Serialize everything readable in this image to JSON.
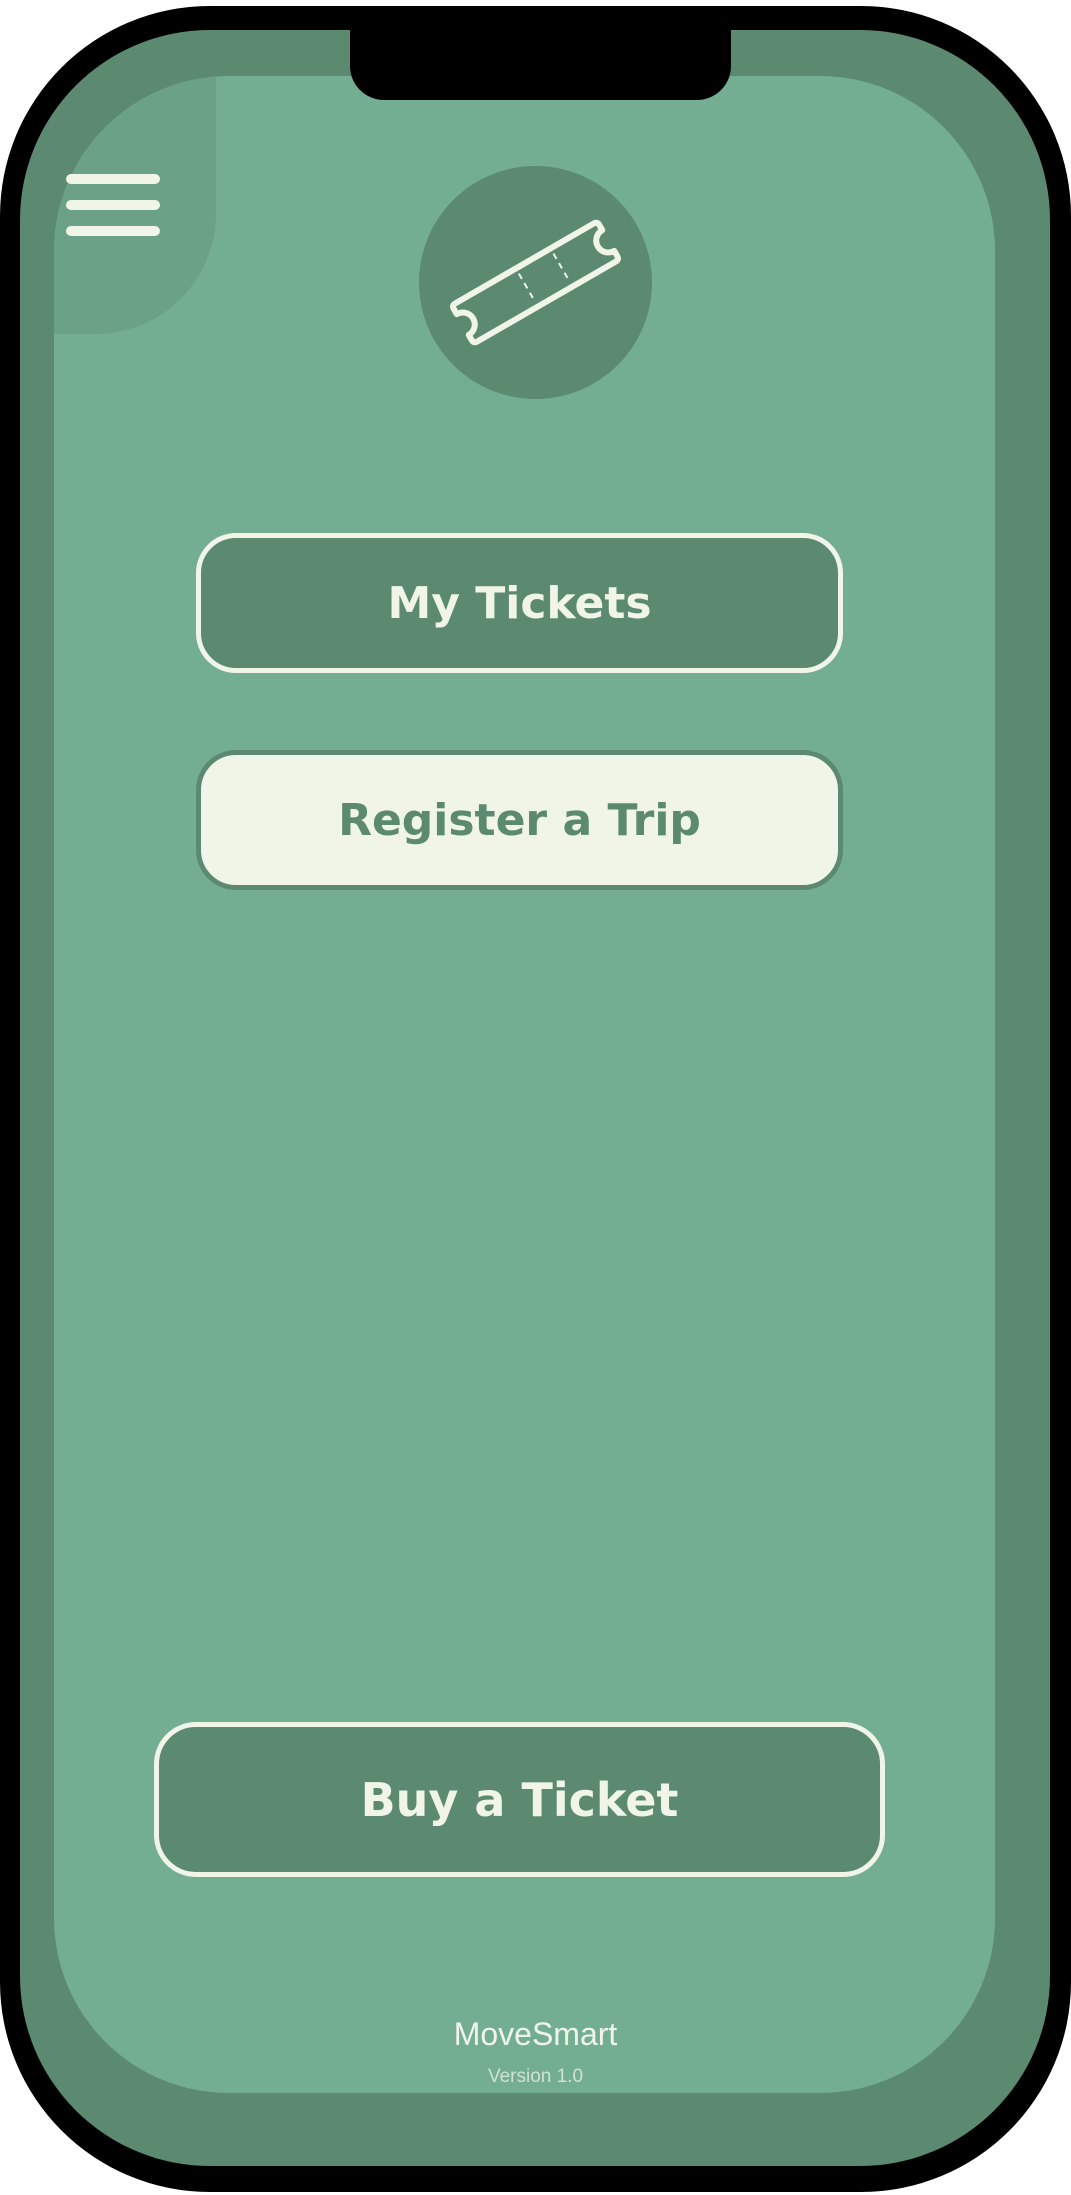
{
  "app": {
    "name": "MoveSmart",
    "version": "Version 1.0"
  },
  "header": {
    "menu_icon": "hamburger-menu-icon",
    "badge_icon": "ticket-icon"
  },
  "actions": {
    "my_tickets_label": "My Tickets",
    "register_trip_label": "Register a Trip",
    "buy_ticket_label": "Buy a Ticket"
  },
  "colors": {
    "frame": "#000000",
    "bezel": "#5b8a70",
    "screen_bg": "#74ae92",
    "accent_dark": "#5b8a70",
    "accent_light": "#f0f5e7"
  }
}
